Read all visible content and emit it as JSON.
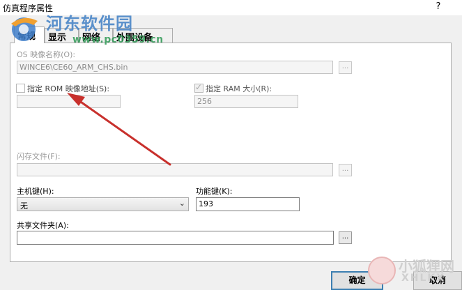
{
  "window": {
    "title": "仿真程序属性",
    "help_label": "?"
  },
  "watermark": {
    "site_name": "河东软件园",
    "url": "www.pc0359.cn"
  },
  "tabs": [
    {
      "label": "常规",
      "active": true
    },
    {
      "label": "显示",
      "active": false
    },
    {
      "label": "网络",
      "active": false
    },
    {
      "label": "外围设备",
      "active": false
    }
  ],
  "general": {
    "os_image_label": "OS 映像名称(O):",
    "os_image_value": "WINCE6\\CE60_ARM_CHS.bin",
    "rom_checkbox_label": "指定 ROM 映像地址(S):",
    "rom_checked": false,
    "rom_value": "",
    "ram_checkbox_label": "指定 RAM 大小(R):",
    "ram_checked": true,
    "ram_value": "256",
    "flash_label": "闪存文件(F):",
    "flash_value": "",
    "host_key_label": "主机键(H):",
    "host_key_value": "无",
    "function_key_label": "功能键(K):",
    "function_key_value": "193",
    "shared_folder_label": "共享文件夹(A):",
    "shared_folder_value": "",
    "browse_label": "..."
  },
  "buttons": {
    "ok": "确定",
    "cancel": "取消"
  },
  "corner_watermark": {
    "text": "小狐狸网",
    "sub": "XHLKX"
  },
  "colors": {
    "annotation_arrow": "#c8302c",
    "tab_panel_bg": "#ffffff",
    "dialog_bg": "#f0f0f0"
  }
}
